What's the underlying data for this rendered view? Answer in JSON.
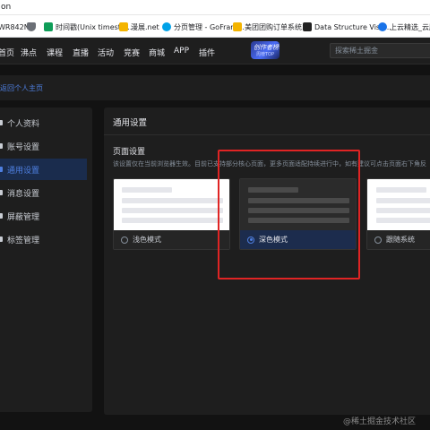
{
  "browser": {
    "url_fragment": "on",
    "bookmarks": [
      {
        "label": "WR842N",
        "color": "#1a73e8",
        "icon": "page-icon"
      },
      {
        "label": "",
        "color": "#6b6f76",
        "icon": "shield-icon"
      },
      {
        "label": "时间戳(Unix timesta...",
        "color": "#0f9d58",
        "icon": "sheet-icon"
      },
      {
        "label": "漫展.net",
        "color": "#f4b400",
        "icon": "folder-icon"
      },
      {
        "label": "分页管理 - GoFram...",
        "color": "#00a2e8",
        "icon": "goframe-icon"
      },
      {
        "label": "美团团购订单系统...",
        "color": "#f4b400",
        "icon": "folder-icon"
      },
      {
        "label": "Data Structure Visu...",
        "color": "#222222",
        "icon": "usf-icon"
      },
      {
        "label": "上云精选_云服务",
        "color": "#1a73e8",
        "icon": "cloud-icon"
      }
    ]
  },
  "site": {
    "nav": [
      "首页",
      "沸点",
      "课程",
      "直播",
      "活动",
      "竞赛",
      "商城",
      "APP",
      "插件"
    ],
    "promo": {
      "title": "创作者榜单",
      "subtitle": "周榜TOP"
    },
    "search_placeholder": "探索稀土掘金"
  },
  "back_link": "返回个人主页",
  "sidebar": {
    "items": [
      {
        "label": "个人资料",
        "active": false,
        "icon": "profile-icon"
      },
      {
        "label": "账号设置",
        "active": false,
        "icon": "account-icon"
      },
      {
        "label": "通用设置",
        "active": true,
        "icon": "settings-icon"
      },
      {
        "label": "消息设置",
        "active": false,
        "icon": "message-icon"
      },
      {
        "label": "屏蔽管理",
        "active": false,
        "icon": "block-icon"
      },
      {
        "label": "标签管理",
        "active": false,
        "icon": "tag-icon"
      }
    ]
  },
  "main": {
    "title": "通用设置",
    "section_title": "页面设置",
    "section_desc": "该设置仅在当前浏览器生效。目前已支持部分核心页面，更多页面适配持续进行中，如有建议可点击页面右下角反",
    "themes": [
      {
        "label": "浅色模式",
        "selected": false
      },
      {
        "label": "深色模式",
        "selected": true
      },
      {
        "label": "跟随系统",
        "selected": false
      }
    ]
  },
  "colors": {
    "accent": "#4e7fe0",
    "highlight": "#e02424",
    "background": "#121212"
  },
  "watermark": "@稀土掘金技术社区"
}
